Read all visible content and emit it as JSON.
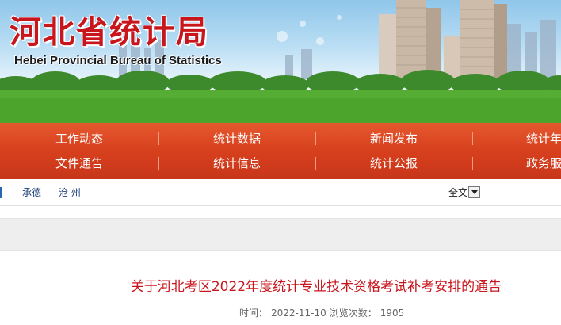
{
  "header": {
    "site_title": "河北省统计局",
    "site_subtitle": "Hebei Provincial Bureau of Statistics"
  },
  "nav": {
    "row1": [
      "工作动态",
      "统计数据",
      "新闻发布",
      "统计年"
    ],
    "row2": [
      "文件通告",
      "统计信息",
      "统计公报",
      "政务服"
    ]
  },
  "citybar": {
    "cities": [
      "承德",
      "沧 州"
    ],
    "language_selected": "全文"
  },
  "article": {
    "title": "关于河北考区2022年度统计专业技术资格考试补考安排的通告",
    "time_label": "时间：",
    "date": "2022-11-10",
    "views_label": "浏览次数：",
    "views": "1905"
  },
  "colors": {
    "brand_red": "#c8161d",
    "nav_orange": "#d7401d",
    "link_blue": "#1d3f7a"
  }
}
